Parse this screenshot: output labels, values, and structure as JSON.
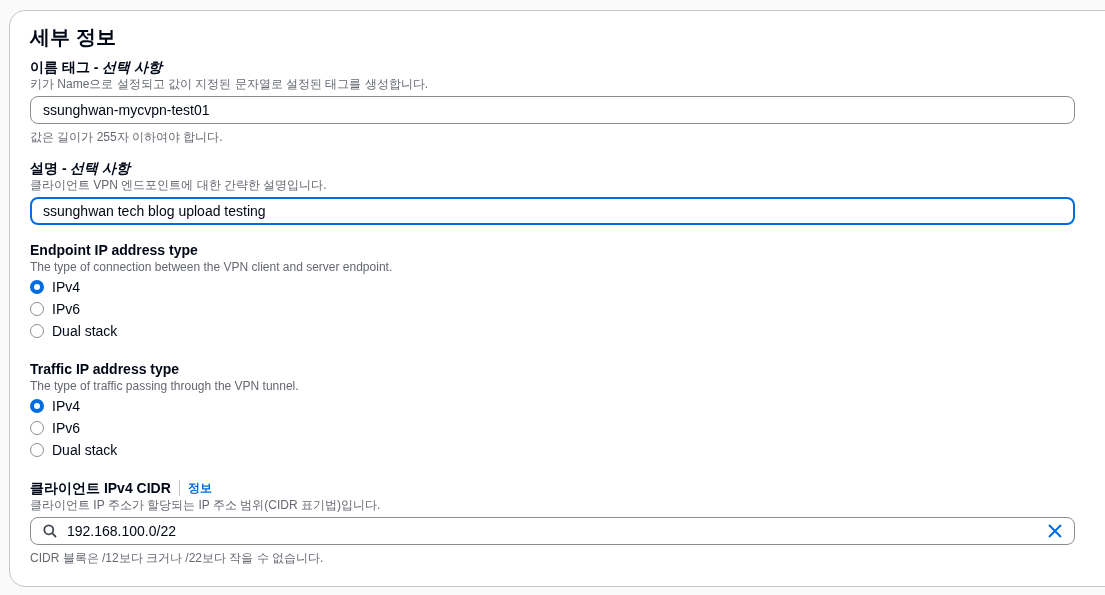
{
  "section": {
    "title": "세부 정보"
  },
  "name_tag": {
    "label": "이름 태그 - *선택 사항*",
    "description": "키가 Name으로 설정되고 값이 지정된 문자열로 설정된 태그를 생성합니다.",
    "value": "ssunghwan-mycvpn-test01",
    "focused": false,
    "hint": "값은 길이가 255자 이하여야 합니다."
  },
  "description_field": {
    "label": "설명 - *선택 사항*",
    "description": "클라이언트 VPN 엔드포인트에 대한 간략한 설명입니다.",
    "value": "ssunghwan tech blog upload testing",
    "focused": true
  },
  "radio_groups": [
    {
      "label": "Endpoint IP address type",
      "description": "The type of connection between the VPN client and server endpoint.",
      "options": [
        {
          "label": "IPv4",
          "selected": true
        },
        {
          "label": "IPv6",
          "selected": false
        },
        {
          "label": "Dual stack",
          "selected": false
        }
      ]
    },
    {
      "label": "Traffic IP address type",
      "description": "The type of traffic passing through the VPN tunnel.",
      "options": [
        {
          "label": "IPv4",
          "selected": true
        },
        {
          "label": "IPv6",
          "selected": false
        },
        {
          "label": "Dual stack",
          "selected": false
        }
      ]
    }
  ],
  "cidr": {
    "label": "클라이언트 IPv4 CIDR",
    "info_link": "정보",
    "description": "클라이언트 IP 주소가 할당되는 IP 주소 범위(CIDR 표기법)입니다.",
    "value": "192.168.100.0/22",
    "hint": "CIDR 블록은 /12보다 크거나 /22보다 작을 수 없습니다."
  }
}
